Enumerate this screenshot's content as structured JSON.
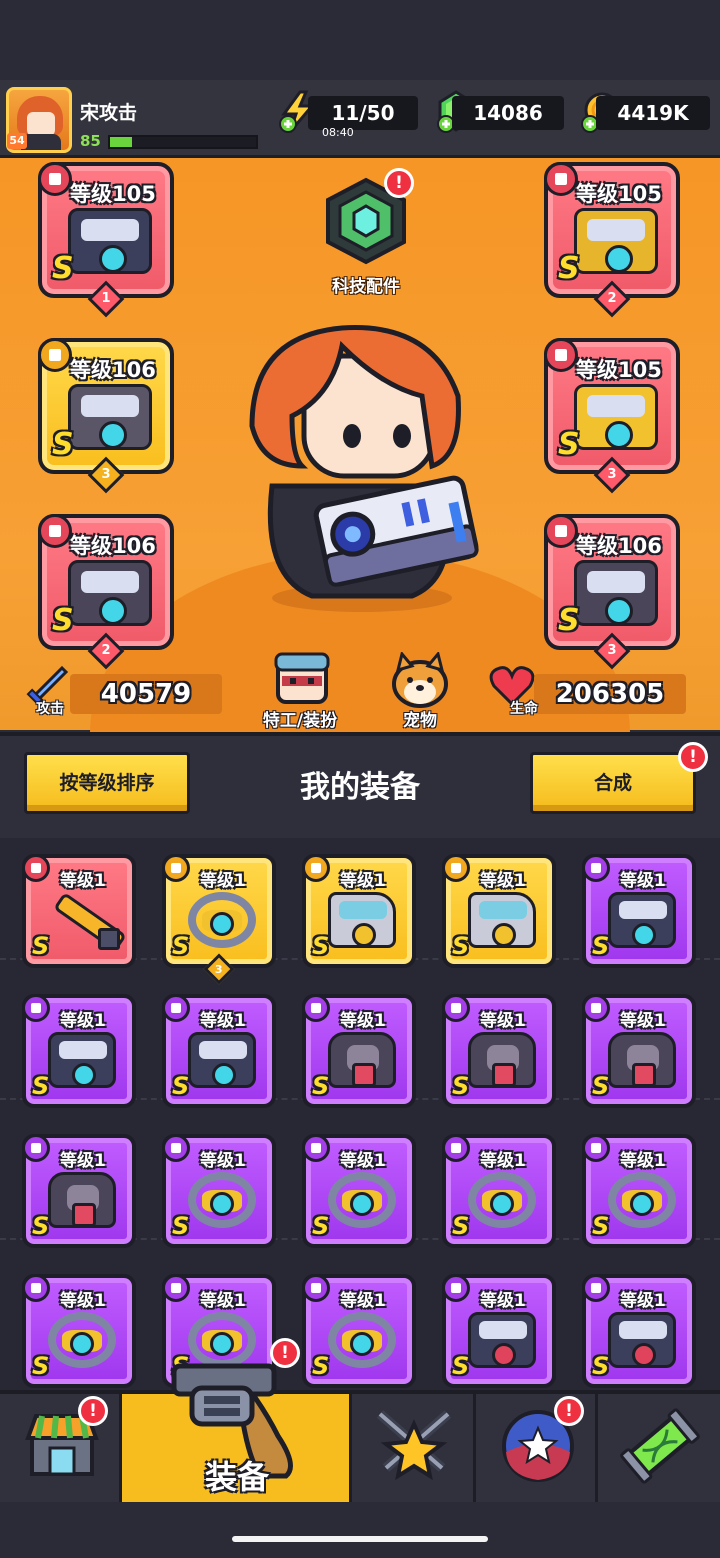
{
  "player": {
    "avatar_level": "54",
    "name": "宋攻击",
    "level": "85",
    "xp_fraction": 0.15
  },
  "resources": {
    "energy": "11/50",
    "energy_timer": "08:40",
    "gems": "14086",
    "coins": "4419K"
  },
  "tech": {
    "label": "科技配件",
    "alert": "!"
  },
  "equipped": [
    {
      "level": "等级105",
      "rank": "S",
      "stars": "1",
      "color": "red"
    },
    {
      "level": "等级106",
      "rank": "S",
      "stars": "3",
      "color": "yellow"
    },
    {
      "level": "等级106",
      "rank": "S",
      "stars": "2",
      "color": "red"
    },
    {
      "level": "等级105",
      "rank": "S",
      "stars": "2",
      "color": "red"
    },
    {
      "level": "等级105",
      "rank": "S",
      "stars": "3",
      "color": "red"
    },
    {
      "level": "等级106",
      "rank": "S",
      "stars": "3",
      "color": "red"
    }
  ],
  "stats": {
    "attack_label": "攻击",
    "attack_value": "40579",
    "hp_label": "生命",
    "hp_value": "206305",
    "agent_label": "特工/装扮",
    "pet_label": "宠物"
  },
  "inventory": {
    "sort_label": "按等级排序",
    "title": "我的装备",
    "merge_label": "合成",
    "merge_alert": "!",
    "items": [
      {
        "level": "等级1",
        "rank": "S",
        "color": "red",
        "art": "sword"
      },
      {
        "level": "等级1",
        "rank": "S",
        "color": "yellow",
        "art": "ring",
        "stars": "3"
      },
      {
        "level": "等级1",
        "rank": "S",
        "color": "yellow",
        "art": "gauntlet"
      },
      {
        "level": "等级1",
        "rank": "S",
        "color": "yellow",
        "art": "gauntlet"
      },
      {
        "level": "等级1",
        "rank": "S",
        "color": "purple",
        "art": "gun"
      },
      {
        "level": "等级1",
        "rank": "S",
        "color": "purple",
        "art": "gun"
      },
      {
        "level": "等级1",
        "rank": "S",
        "color": "purple",
        "art": "gun"
      },
      {
        "level": "等级1",
        "rank": "S",
        "color": "purple",
        "art": "armor"
      },
      {
        "level": "等级1",
        "rank": "S",
        "color": "purple",
        "art": "armor"
      },
      {
        "level": "等级1",
        "rank": "S",
        "color": "purple",
        "art": "armor"
      },
      {
        "level": "等级1",
        "rank": "S",
        "color": "purple",
        "art": "armor"
      },
      {
        "level": "等级1",
        "rank": "S",
        "color": "purple",
        "art": "ring"
      },
      {
        "level": "等级1",
        "rank": "S",
        "color": "purple",
        "art": "belt"
      },
      {
        "level": "等级1",
        "rank": "S",
        "color": "purple",
        "art": "belt"
      },
      {
        "level": "等级1",
        "rank": "S",
        "color": "purple",
        "art": "belt"
      },
      {
        "level": "等级1",
        "rank": "S",
        "color": "purple",
        "art": "belt"
      },
      {
        "level": "等级1",
        "rank": "S",
        "color": "purple",
        "art": "belt"
      },
      {
        "level": "等级1",
        "rank": "S",
        "color": "purple",
        "art": "belt"
      },
      {
        "level": "等级1",
        "rank": "S",
        "color": "purple",
        "art": "heart"
      },
      {
        "level": "等级1",
        "rank": "S",
        "color": "purple",
        "art": "heart"
      }
    ]
  },
  "nav": {
    "equip_label": "装备",
    "shop_alert": "!",
    "equip_alert": "!",
    "orb_alert": "!"
  },
  "colors": {
    "bg_orange": "#f69626",
    "rarity_red": "#f05a69",
    "rarity_yellow": "#f9be1e",
    "rarity_purple": "#9f36ee",
    "nav_active": "#f7bd1f"
  }
}
